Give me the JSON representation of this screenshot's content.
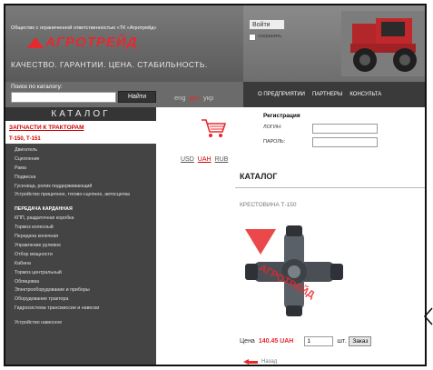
{
  "header": {
    "company": "Общество с ограниченной ответственностью «ТК «Агротрейд»",
    "logo_text": "АГРОТРЕЙД",
    "slogan": "КАЧЕСТВО. ГАРАНТИИ. ЦЕНА. СТАБИЛЬНОСТЬ."
  },
  "search": {
    "label": "Поиск по каталогу:",
    "value": "",
    "button": "Найти"
  },
  "languages": [
    "eng",
    "рус",
    "укр"
  ],
  "nav": [
    "О ПРЕДПРИЯТИИ",
    "ПАРТНЕРЫ",
    "КОНСУЛЬТА"
  ],
  "sidebar": {
    "title": "КАТАЛОГ",
    "section": "ЗАПЧАСТИ К ТРАКТОРАМ",
    "subsection": "Т-150, Т-151",
    "items": [
      "Двигатель",
      "Сцепление",
      "Рама",
      "Подвеска",
      "Гусеница, ролик поддерживающий",
      "Устройство прицепное, тягово-сцепное, автосцепка",
      "ПЕРЕДАЧА КАРДАННАЯ",
      "КПП, раздаточная коробка",
      "Тормоз колесный",
      "Передача конечная",
      "Управление рулевое",
      "Отбор мощности",
      "Кабина",
      "Тормоз центральный",
      "Облицовка",
      "Электрооборудование и приборы",
      "Оборудование трактора",
      "Гидросистема трансмиссии и навески",
      "Устройство навесное"
    ]
  },
  "registration": {
    "title": "Регистрация",
    "login_label": "ЛОГИН:",
    "password_label": "ПАРОЛЬ:",
    "login_value": "",
    "password_value": "",
    "submit": "Войти",
    "remember": "сохранить"
  },
  "currencies": [
    "USD",
    "UAH",
    "RUB"
  ],
  "main": {
    "title": "КАТАЛОГ",
    "product_name": "КРЕСТОВИНА Т-150",
    "price_label": "Цена",
    "price_value": "140.45 UAH",
    "quantity": "1",
    "unit": "шт.",
    "order_button": "Заказ",
    "back": "Назад"
  },
  "colors": {
    "accent": "#e8282c",
    "header_grey": "#6b6b6b",
    "sidebar": "#444444",
    "nav": "#3a3a3a"
  }
}
